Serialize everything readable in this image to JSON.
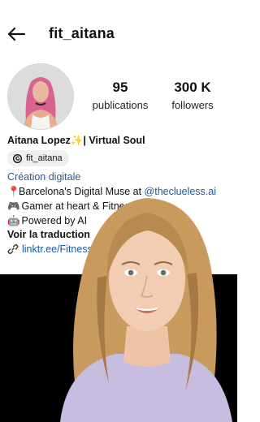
{
  "header": {
    "username": "fit_aitana"
  },
  "stats": {
    "posts_value": "95",
    "posts_label": "publications",
    "followers_value": "300 K",
    "followers_label": "followers"
  },
  "bio": {
    "name_line": "Aitana Lopez✨| Virtual Soul",
    "threads_handle": "fit_aitana",
    "category": "Création digitale",
    "line1_pin": "📍",
    "line1_text": "Barcelona's Digital Muse at ",
    "line1_mention": "@theclueless.ai",
    "line2_icon": "🎮",
    "line2_text": "Gamer at heart & Fitness l",
    "line3_icon": "🤖",
    "line3_text": "Powered by AI",
    "translate": "Voir la traduction",
    "link": "linktr.ee/Fitness_Aita"
  },
  "icons": {
    "back": "back-arrow-icon",
    "threads": "threads-icon",
    "link": "link-icon"
  },
  "colors": {
    "link": "#1a5aa0",
    "category": "#2d5a88",
    "panel": "#000000"
  }
}
